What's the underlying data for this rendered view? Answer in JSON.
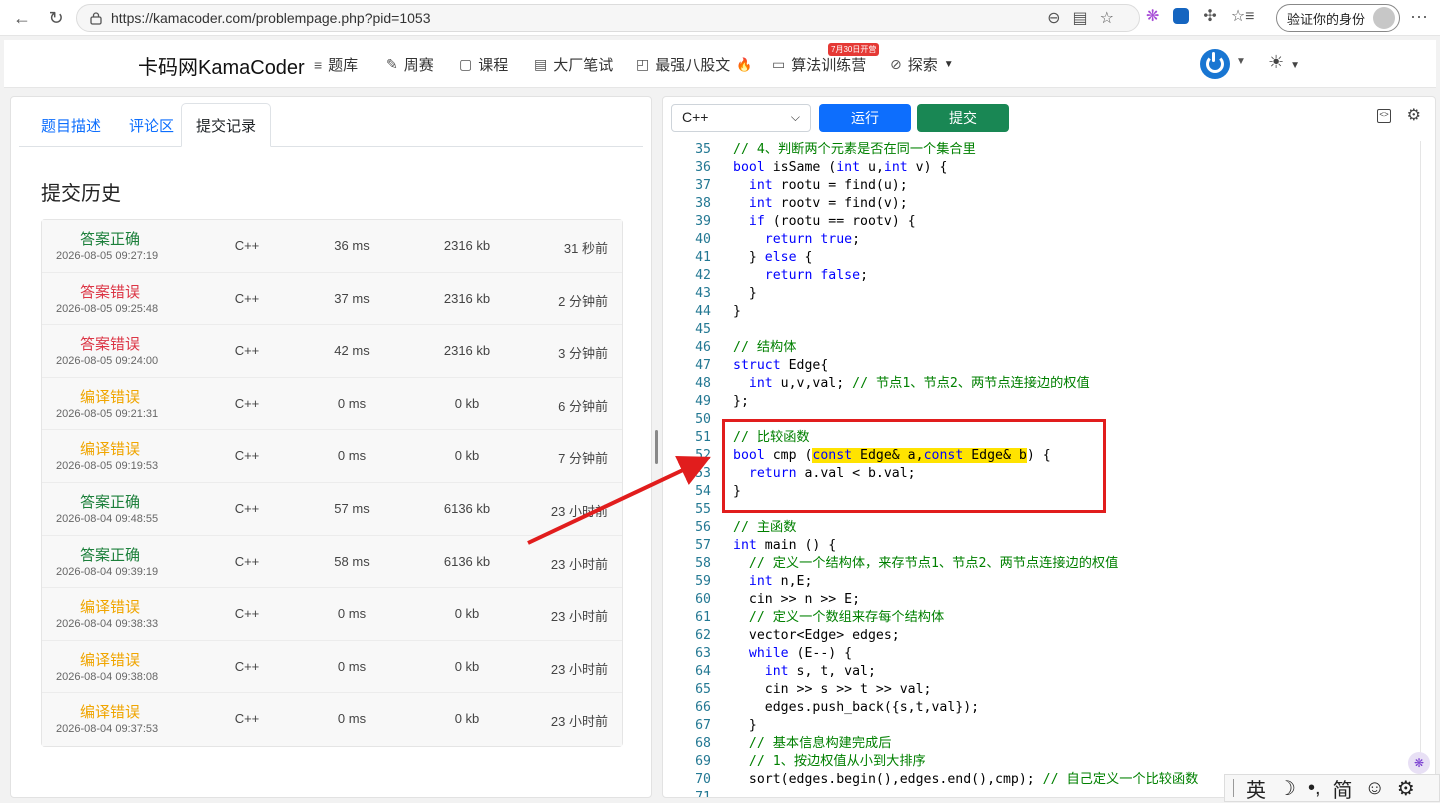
{
  "browser": {
    "url": "https://kamacoder.com/problempage.php?pid=1053",
    "verify_label": "验证你的身份",
    "back_icon": "arrow-left-icon",
    "reload_icon": "reload-icon"
  },
  "site": {
    "brand": "卡码网KamaCoder",
    "nav": [
      {
        "label": "题库",
        "icon": "≡"
      },
      {
        "label": "周赛",
        "icon": "✎"
      },
      {
        "label": "课程",
        "icon": "▢"
      },
      {
        "label": "大厂笔试",
        "icon": "▤"
      },
      {
        "label": "最强八股文",
        "icon": "◰"
      },
      {
        "label": "算法训练营",
        "icon": "▭"
      },
      {
        "label": "探索",
        "icon": "⊘"
      }
    ],
    "camp_badge": "7月30日开营",
    "fire": "🔥"
  },
  "left": {
    "tabs": [
      "题目描述",
      "评论区",
      "提交记录"
    ],
    "active_tab": 2,
    "history_title": "提交历史",
    "submissions": [
      {
        "status": "答案正确",
        "type": "ok",
        "time": "2026-08-05 09:27:19",
        "lang": "C++",
        "runtime": "36 ms",
        "memory": "2316 kb",
        "ago": "31 秒前"
      },
      {
        "status": "答案错误",
        "type": "err",
        "time": "2026-08-05 09:25:48",
        "lang": "C++",
        "runtime": "37 ms",
        "memory": "2316 kb",
        "ago": "2 分钟前"
      },
      {
        "status": "答案错误",
        "type": "err",
        "time": "2026-08-05 09:24:00",
        "lang": "C++",
        "runtime": "42 ms",
        "memory": "2316 kb",
        "ago": "3 分钟前"
      },
      {
        "status": "编译错误",
        "type": "ce",
        "time": "2026-08-05 09:21:31",
        "lang": "C++",
        "runtime": "0 ms",
        "memory": "0 kb",
        "ago": "6 分钟前"
      },
      {
        "status": "编译错误",
        "type": "ce",
        "time": "2026-08-05 09:19:53",
        "lang": "C++",
        "runtime": "0 ms",
        "memory": "0 kb",
        "ago": "7 分钟前"
      },
      {
        "status": "答案正确",
        "type": "ok",
        "time": "2026-08-04 09:48:55",
        "lang": "C++",
        "runtime": "57 ms",
        "memory": "6136 kb",
        "ago": "23 小时前"
      },
      {
        "status": "答案正确",
        "type": "ok",
        "time": "2026-08-04 09:39:19",
        "lang": "C++",
        "runtime": "58 ms",
        "memory": "6136 kb",
        "ago": "23 小时前"
      },
      {
        "status": "编译错误",
        "type": "ce",
        "time": "2026-08-04 09:38:33",
        "lang": "C++",
        "runtime": "0 ms",
        "memory": "0 kb",
        "ago": "23 小时前"
      },
      {
        "status": "编译错误",
        "type": "ce",
        "time": "2026-08-04 09:38:08",
        "lang": "C++",
        "runtime": "0 ms",
        "memory": "0 kb",
        "ago": "23 小时前"
      },
      {
        "status": "编译错误",
        "type": "ce",
        "time": "2026-08-04 09:37:53",
        "lang": "C++",
        "runtime": "0 ms",
        "memory": "0 kb",
        "ago": "23 小时前"
      }
    ]
  },
  "right": {
    "language": "C++",
    "run_label": "运行",
    "submit_label": "提交",
    "code_lines": [
      {
        "n": 35,
        "html": "<span class='cm'>// 4、判断两个元素是否在同一个集合里</span>"
      },
      {
        "n": 36,
        "html": "<span class='kw'>bool</span> isSame (<span class='kw'>int</span> u,<span class='kw'>int</span> v) {"
      },
      {
        "n": 37,
        "html": "  <span class='kw'>int</span> rootu = find(u);"
      },
      {
        "n": 38,
        "html": "  <span class='kw'>int</span> rootv = find(v);"
      },
      {
        "n": 39,
        "html": "  <span class='kw'>if</span> (rootu == rootv) {"
      },
      {
        "n": 40,
        "html": "    <span class='kw'>return</span> <span class='kw'>true</span>;"
      },
      {
        "n": 41,
        "html": "  } <span class='kw'>else</span> {"
      },
      {
        "n": 42,
        "html": "    <span class='kw'>return</span> <span class='kw'>false</span>;"
      },
      {
        "n": 43,
        "html": "  }"
      },
      {
        "n": 44,
        "html": "}"
      },
      {
        "n": 45,
        "html": ""
      },
      {
        "n": 46,
        "html": "<span class='cm'>// 结构体</span>"
      },
      {
        "n": 47,
        "html": "<span class='kw'>struct</span> Edge{"
      },
      {
        "n": 48,
        "html": "  <span class='kw'>int</span> u,v,val; <span class='cm'>// 节点1、节点2、两节点连接边的权值</span>"
      },
      {
        "n": 49,
        "html": "};"
      },
      {
        "n": 50,
        "html": ""
      },
      {
        "n": 51,
        "html": "<span class='cm'>// 比较函数</span>"
      },
      {
        "n": 52,
        "html": "<span class='kw'>bool</span> cmp (<span class='hl'><span class='kw'>const</span> Edge&amp; a,<span class='kw'>const</span> Edge&amp; b</span>) {"
      },
      {
        "n": 53,
        "html": "  <span class='kw'>return</span> a.val &lt; b.val;"
      },
      {
        "n": 54,
        "html": "}"
      },
      {
        "n": 55,
        "html": ""
      },
      {
        "n": 56,
        "html": "<span class='cm'>// 主函数</span>"
      },
      {
        "n": 57,
        "html": "<span class='kw'>int</span> main () {"
      },
      {
        "n": 58,
        "html": "  <span class='cm'>// 定义一个结构体，来存节点1、节点2、两节点连接边的权值</span>"
      },
      {
        "n": 59,
        "html": "  <span class='kw'>int</span> n,E;"
      },
      {
        "n": 60,
        "html": "  cin &gt;&gt; n &gt;&gt; E;"
      },
      {
        "n": 61,
        "html": "  <span class='cm'>// 定义一个数组来存每个结构体</span>"
      },
      {
        "n": 62,
        "html": "  vector&lt;Edge&gt; edges;"
      },
      {
        "n": 63,
        "html": "  <span class='kw'>while</span> (E--) {"
      },
      {
        "n": 64,
        "html": "    <span class='kw'>int</span> s, t, val;"
      },
      {
        "n": 65,
        "html": "    cin &gt;&gt; s &gt;&gt; t &gt;&gt; val;"
      },
      {
        "n": 66,
        "html": "    edges.push_back({s,t,val});"
      },
      {
        "n": 67,
        "html": "  }"
      },
      {
        "n": 68,
        "html": "  <span class='cm'>// 基本信息构建完成后</span>"
      },
      {
        "n": 69,
        "html": "  <span class='cm'>// 1、按边权值从小到大排序</span>"
      },
      {
        "n": 70,
        "html": "  sort(edges.begin(),edges.end(),cmp); <span class='cm'>// 自己定义一个比较函数</span>"
      },
      {
        "n": 71,
        "html": ""
      }
    ]
  },
  "ime": {
    "lang": "英",
    "moon": "☽",
    "punct": "•,",
    "mode": "简",
    "emoji": "☺",
    "gear": "⚙"
  }
}
